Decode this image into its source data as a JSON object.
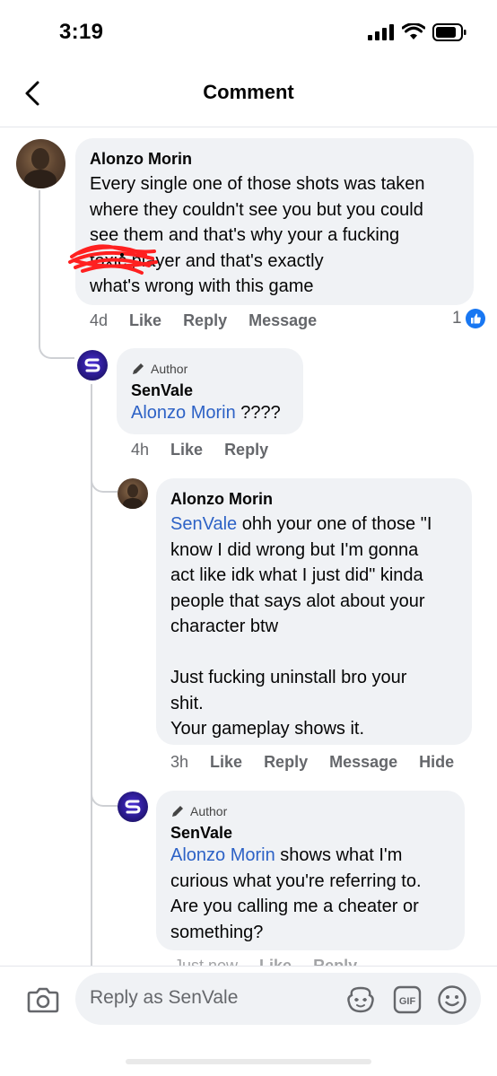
{
  "status_bar": {
    "time": "3:19"
  },
  "header": {
    "title": "Comment"
  },
  "comments": [
    {
      "author": "Alonzo Morin",
      "text": "Every single one of those shots was taken\nwhere they couldn't see you but you could\nsee them and that's why your a fucking\n          toxic player and that's exactly\nwhat's wrong with this game",
      "time": "4d",
      "actions": [
        "Like",
        "Reply",
        "Message"
      ],
      "like_count": "1"
    },
    {
      "badge": "Author",
      "author": "SenVale",
      "mention": "Alonzo Morin",
      "text": " ????",
      "time": "4h",
      "actions": [
        "Like",
        "Reply"
      ]
    },
    {
      "author": "Alonzo Morin",
      "mention": "SenVale",
      "text": " ohh your one of those \"I\nknow I did wrong but I'm gonna\nact like idk what I just did\"  kinda\npeople that says alot about your\ncharacter btw\n\nJust fucking uninstall bro your\nshit.\nYour gameplay shows it.",
      "time": "3h",
      "actions": [
        "Like",
        "Reply",
        "Message",
        "Hide"
      ]
    },
    {
      "badge": "Author",
      "author": "SenVale",
      "mention": "Alonzo Morin",
      "text": " shows what I'm\ncurious what you're referring to.\nAre you calling me a cheater or\nsomething?",
      "time": "Just now",
      "actions": [
        "Like",
        "Reply"
      ]
    }
  ],
  "composer": {
    "placeholder": "Reply as SenVale"
  },
  "icons": [
    "camera-icon",
    "avatar-sticker-icon",
    "gif-icon",
    "emoji-icon"
  ]
}
